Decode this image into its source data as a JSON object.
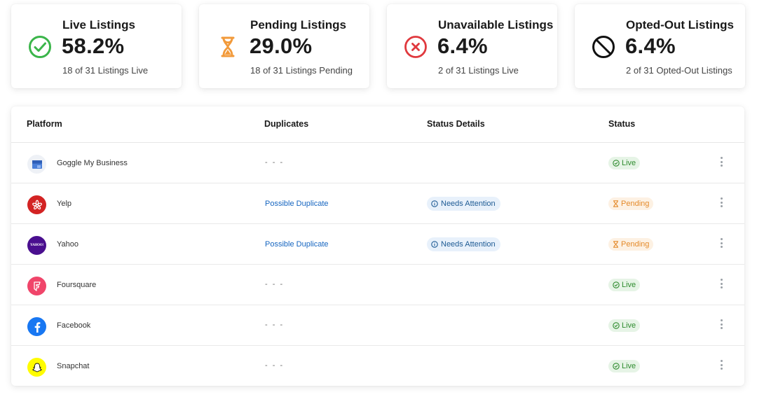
{
  "cards": [
    {
      "title": "Live Listings",
      "percent": "58.2%",
      "subtitle": "18 of 31 Listings Live",
      "icon": "check-circle-icon",
      "color": "#3bb54a"
    },
    {
      "title": "Pending Listings",
      "percent": "29.0%",
      "subtitle": "18 of 31 Listings Pending",
      "icon": "hourglass-icon",
      "color": "#f29a3a"
    },
    {
      "title": "Unavailable Listings",
      "percent": "6.4%",
      "subtitle": "2 of 31 Listings Live",
      "icon": "x-circle-icon",
      "color": "#e0393e"
    },
    {
      "title": "Opted-Out Listings",
      "percent": "6.4%",
      "subtitle": "2 of 31 Opted-Out Listings",
      "icon": "block-icon",
      "color": "#111111"
    }
  ],
  "table": {
    "headers": {
      "platform": "Platform",
      "duplicates": "Duplicates",
      "details": "Status Details",
      "status": "Status"
    },
    "rows": [
      {
        "platform": "Goggle My Business",
        "logo": "google-my-business-logo",
        "duplicates": "- - -",
        "details": "",
        "status": "Live"
      },
      {
        "platform": "Yelp",
        "logo": "yelp-logo",
        "duplicates": "Possible Duplicate",
        "details": "Needs Attention",
        "status": "Pending"
      },
      {
        "platform": "Yahoo",
        "logo": "yahoo-logo",
        "logo_text": "YAHOO!",
        "duplicates": "Possible Duplicate",
        "details": "Needs Attention",
        "status": "Pending"
      },
      {
        "platform": "Foursquare",
        "logo": "foursquare-logo",
        "duplicates": "- - -",
        "details": "",
        "status": "Live"
      },
      {
        "platform": "Facebook",
        "logo": "facebook-logo",
        "duplicates": "- - -",
        "details": "",
        "status": "Live"
      },
      {
        "platform": "Snapchat",
        "logo": "snapchat-logo",
        "duplicates": "- - -",
        "details": "",
        "status": "Live"
      }
    ]
  },
  "colors": {
    "live_bg": "#e6f4e6",
    "live_text": "#2e8b2e",
    "pending_bg": "#fdf1e3",
    "pending_text": "#e48a2a",
    "attention_bg": "#e8f1fb",
    "attention_text": "#1e5b94",
    "link": "#1565c0"
  }
}
